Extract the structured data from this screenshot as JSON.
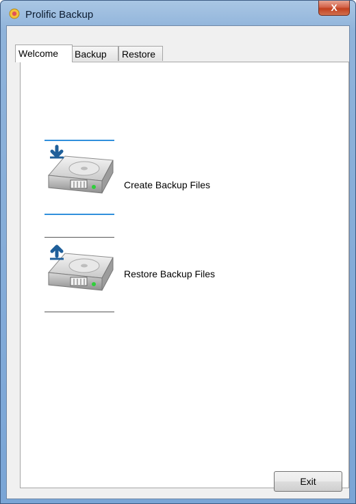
{
  "window": {
    "title": "Prolific Backup",
    "close_label": "X"
  },
  "tabs": [
    {
      "label": "Welcome",
      "active": true
    },
    {
      "label": "Backup",
      "active": false
    },
    {
      "label": "Restore",
      "active": false
    }
  ],
  "actions": [
    {
      "label": "Create Backup Files",
      "icon": "drive-download-icon",
      "selected": true
    },
    {
      "label": "Restore Backup Files",
      "icon": "drive-upload-icon",
      "selected": false
    }
  ],
  "footer": {
    "exit_label": "Exit"
  },
  "colors": {
    "accent": "#2f8fdc",
    "arrow": "#1f5f9a",
    "led": "#2fcf3a"
  }
}
